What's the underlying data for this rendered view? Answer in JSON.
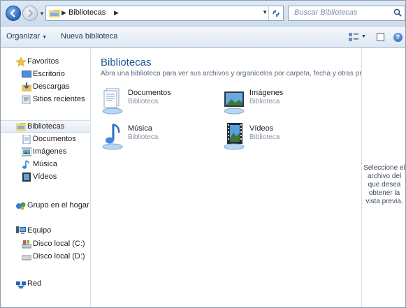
{
  "address_bar": {
    "breadcrumb": "Bibliotecas",
    "search_placeholder": "Buscar Bibliotecas"
  },
  "toolbar": {
    "organize_label": "Organizar",
    "new_library_label": "Nueva biblioteca"
  },
  "navigation": {
    "favorites": {
      "label": "Favoritos",
      "items": [
        {
          "label": "Escritorio",
          "icon": "desktop-icon"
        },
        {
          "label": "Descargas",
          "icon": "downloads-icon"
        },
        {
          "label": "Sitios recientes",
          "icon": "recent-places-icon"
        }
      ]
    },
    "libraries": {
      "label": "Bibliotecas",
      "items": [
        {
          "label": "Documentos",
          "icon": "documents-icon"
        },
        {
          "label": "Imágenes",
          "icon": "pictures-icon"
        },
        {
          "label": "Música",
          "icon": "music-icon"
        },
        {
          "label": "Vídeos",
          "icon": "videos-icon"
        }
      ]
    },
    "homegroup": {
      "label": "Grupo en el hogar"
    },
    "computer": {
      "label": "Equipo",
      "items": [
        {
          "label": "Disco local (C:)",
          "icon": "system-drive-icon"
        },
        {
          "label": "Disco local (D:)",
          "icon": "drive-icon"
        }
      ]
    },
    "network": {
      "label": "Red"
    }
  },
  "content": {
    "title": "Bibliotecas",
    "subtitle": "Abra una biblioteca para ver sus archivos y organícelos por carpeta, fecha y otras propiedades.",
    "libraries": [
      {
        "name": "Documentos",
        "type": "Biblioteca",
        "icon": "documents-library-icon"
      },
      {
        "name": "Imágenes",
        "type": "Biblioteca",
        "icon": "pictures-library-icon"
      },
      {
        "name": "Música",
        "type": "Biblioteca",
        "icon": "music-library-icon"
      },
      {
        "name": "Vídeos",
        "type": "Biblioteca",
        "icon": "videos-library-icon"
      }
    ]
  },
  "preview_pane": {
    "message": "Seleccione el archivo del que desea obtener la vista previa."
  },
  "colors": {
    "accent_title": "#1e5799",
    "toolbar_text": "#1e395b",
    "selected_nav": "#e6ebf1"
  }
}
